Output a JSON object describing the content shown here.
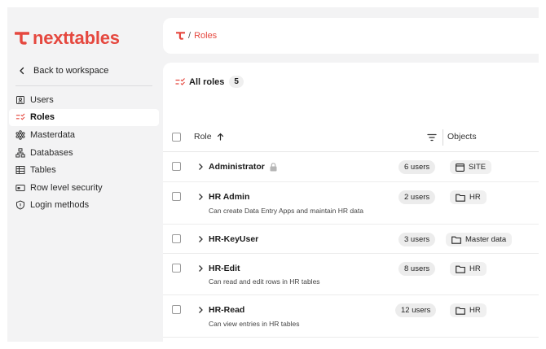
{
  "brand": {
    "name": "nexttables",
    "color": "#e5483f"
  },
  "sidebar": {
    "back_label": "Back to workspace",
    "items": [
      {
        "label": "Users",
        "icon": "user-badge-icon",
        "active": false
      },
      {
        "label": "Roles",
        "icon": "roles-checklist-icon",
        "active": true
      },
      {
        "label": "Masterdata",
        "icon": "masterdata-icon",
        "active": false
      },
      {
        "label": "Databases",
        "icon": "database-tree-icon",
        "active": false
      },
      {
        "label": "Tables",
        "icon": "table-icon",
        "active": false
      },
      {
        "label": "Row level security",
        "icon": "row-security-icon",
        "active": false
      },
      {
        "label": "Login methods",
        "icon": "shield-icon",
        "active": false
      }
    ]
  },
  "breadcrumb": {
    "separator": "/",
    "current": "Roles"
  },
  "main": {
    "tab_label": "All roles",
    "tab_count": "5",
    "columns": {
      "role": "Role",
      "objects": "Objects"
    },
    "rows": [
      {
        "name": "Administrator",
        "locked": true,
        "description": "",
        "users": "6 users",
        "object": "SITE",
        "object_icon": "window-icon"
      },
      {
        "name": "HR Admin",
        "locked": false,
        "description": "Can create Data Entry Apps and maintain HR data",
        "users": "2 users",
        "object": "HR",
        "object_icon": "folder-icon"
      },
      {
        "name": "HR-KeyUser",
        "locked": false,
        "description": "",
        "users": "3 users",
        "object": "Master data",
        "object_icon": "folder-icon"
      },
      {
        "name": "HR-Edit",
        "locked": false,
        "description": "Can read and edit rows in HR tables",
        "users": "8 users",
        "object": "HR",
        "object_icon": "folder-icon"
      },
      {
        "name": "HR-Read",
        "locked": false,
        "description": "Can view entries in HR tables",
        "users": "12 users",
        "object": "HR",
        "object_icon": "folder-icon"
      }
    ]
  }
}
